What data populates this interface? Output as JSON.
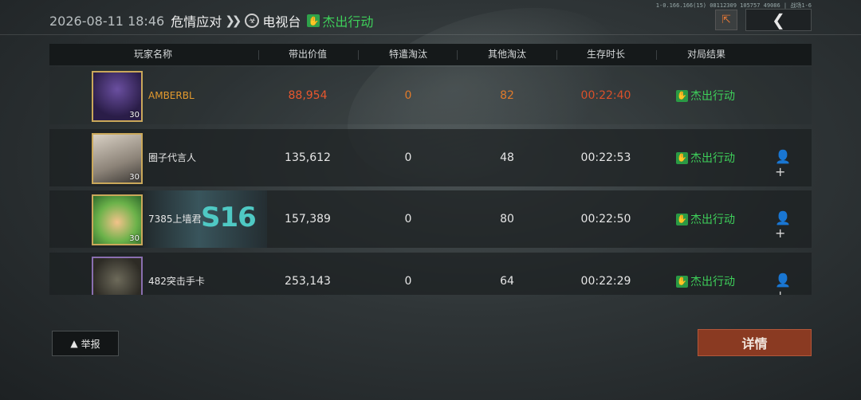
{
  "debug_info": "1-0.166.166(15) 08112309 105757 49086 | 战场1-6",
  "header": {
    "date": "2026-08-11 18:46",
    "mode": "危情应对",
    "map": "电视台",
    "result": "杰出行动"
  },
  "table": {
    "columns": [
      "玩家名称",
      "带出价值",
      "特遣淘汰",
      "其他淘汰",
      "生存时长",
      "对局结果"
    ],
    "rows": [
      {
        "name": "AMBERBL",
        "level": "30",
        "value": "88,954",
        "special_elims": "0",
        "other_elims": "82",
        "survival": "00:22:40",
        "result": "杰出行动",
        "is_self": true
      },
      {
        "name": "圈子代言人",
        "level": "30",
        "value": "135,612",
        "special_elims": "0",
        "other_elims": "48",
        "survival": "00:22:53",
        "result": "杰出行动"
      },
      {
        "name": "7385上墙君",
        "level": "30",
        "value": "157,389",
        "special_elims": "0",
        "other_elims": "80",
        "survival": "00:22:50",
        "result": "杰出行动",
        "banner": "S16"
      },
      {
        "name": "482突击手卡",
        "level": "",
        "value": "253,143",
        "special_elims": "0",
        "other_elims": "64",
        "survival": "00:22:29",
        "result": "杰出行动"
      }
    ]
  },
  "buttons": {
    "report": "举报",
    "details": "详情"
  },
  "colors": {
    "result_green": "#3ecf5a",
    "self_orange": "#e39a2e",
    "self_red": "#e8572e",
    "detail_button": "#8a3a22"
  }
}
